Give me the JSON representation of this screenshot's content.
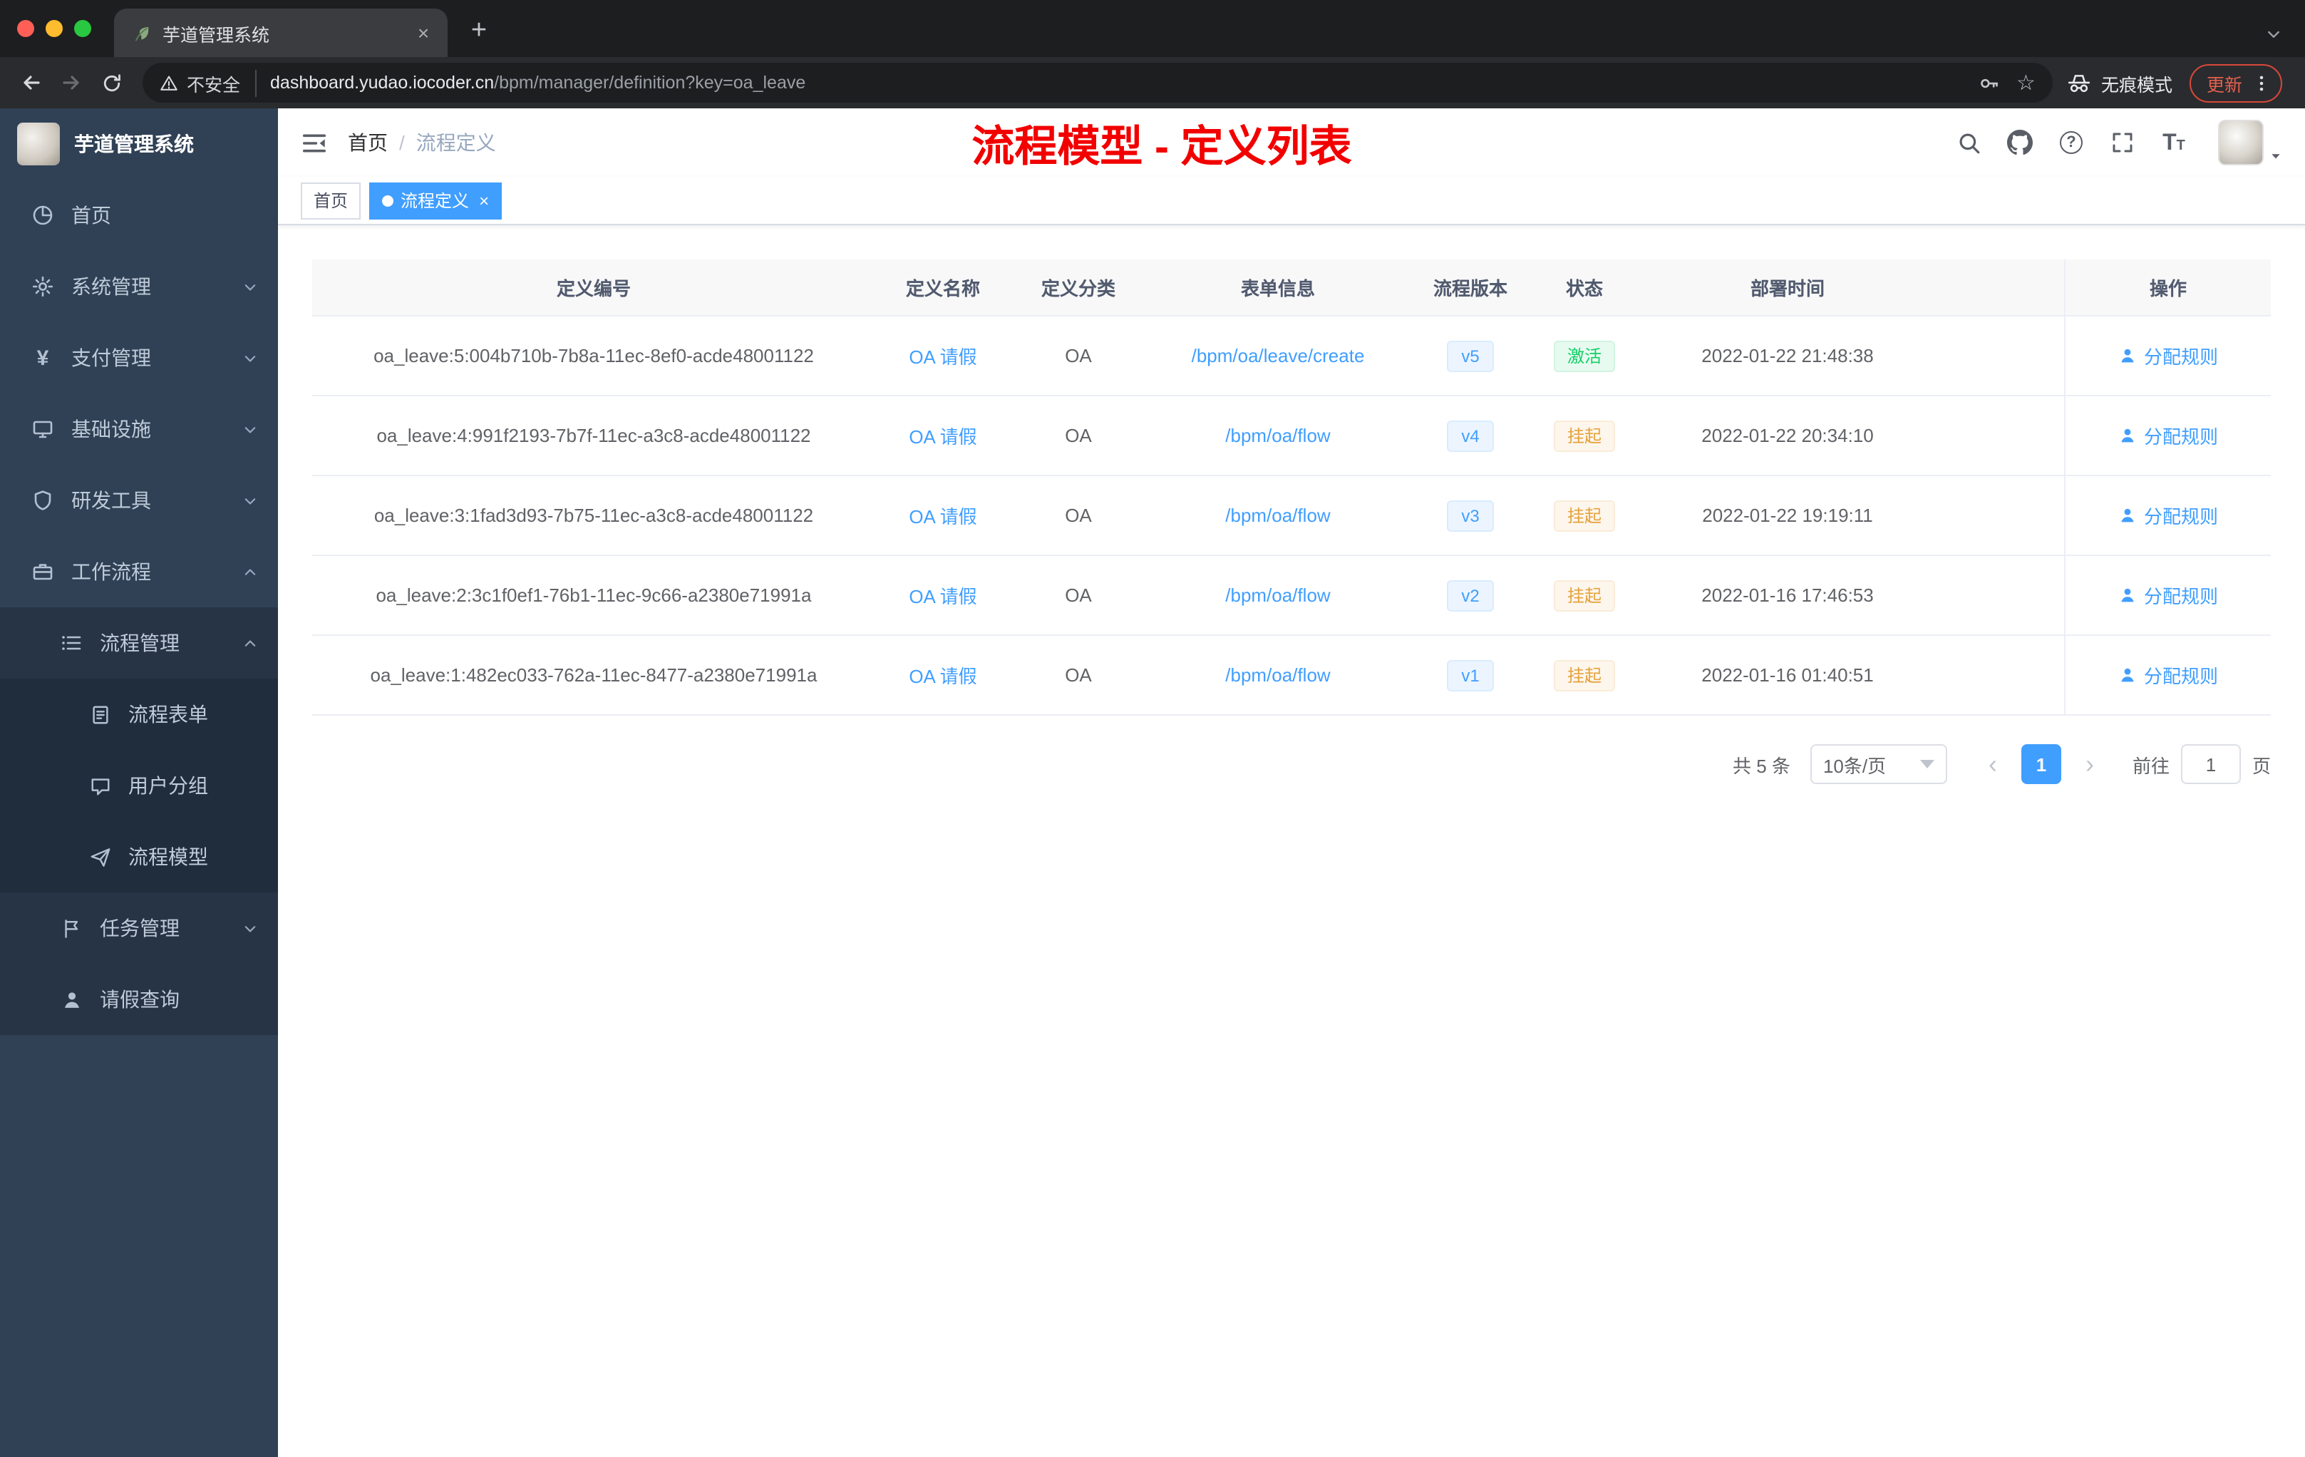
{
  "colors": {
    "accent_blue": "#409eff",
    "annotation_red": "#f20000",
    "status_active_green": "#13ce66",
    "status_suspend_orange": "#e6a23c",
    "sidebar_bg": "#304156",
    "chrome_dark": "#1d1e20"
  },
  "browser": {
    "tab_title": "芋道管理系统",
    "tab_close_glyph": "×",
    "new_tab_glyph": "+",
    "security_label": "不安全",
    "url_host": "dashboard.yudao.iocoder.cn",
    "url_path": "/bpm/manager/definition?key=oa_leave",
    "star_glyph": "☆",
    "incognito_label": "无痕模式",
    "update_label": "更新"
  },
  "sidebar": {
    "logo_title": "芋道管理系统",
    "items": [
      {
        "label": "首页",
        "icon": "dashboard-icon"
      },
      {
        "label": "系统管理",
        "icon": "gear-icon",
        "expand": "down"
      },
      {
        "label": "支付管理",
        "icon": "yen-icon",
        "glyph": "¥",
        "expand": "down"
      },
      {
        "label": "基础设施",
        "icon": "monitor-icon",
        "expand": "down"
      },
      {
        "label": "研发工具",
        "icon": "shield-icon",
        "expand": "down"
      },
      {
        "label": "工作流程",
        "icon": "briefcase-icon",
        "expand": "up"
      },
      {
        "label": "流程管理",
        "icon": "list-icon",
        "expand": "up",
        "level": 1
      },
      {
        "label": "流程表单",
        "icon": "form-icon",
        "level": 2
      },
      {
        "label": "用户分组",
        "icon": "chat-icon",
        "level": 2
      },
      {
        "label": "流程模型",
        "icon": "send-icon",
        "level": 2
      },
      {
        "label": "任务管理",
        "icon": "flag-icon",
        "expand": "down",
        "level": 1
      },
      {
        "label": "请假查询",
        "icon": "person-icon",
        "level": 1
      }
    ]
  },
  "header": {
    "breadcrumb": {
      "home": "首页",
      "separator": "/",
      "current": "流程定义"
    },
    "annotation": "流程模型 - 定义列表",
    "question_glyph": "?",
    "font_large_glyph": "T",
    "font_small_glyph": "T"
  },
  "tags": {
    "items": [
      {
        "label": "首页",
        "active": false
      },
      {
        "label": "流程定义",
        "active": true,
        "close_glyph": "×"
      }
    ]
  },
  "table": {
    "columns": [
      "定义编号",
      "定义名称",
      "定义分类",
      "表单信息",
      "流程版本",
      "状态",
      "部署时间",
      "操作"
    ],
    "rows": [
      {
        "id": "oa_leave:5:004b710b-7b8a-11ec-8ef0-acde48001122",
        "name": "OA 请假",
        "category": "OA",
        "form": "/bpm/oa/leave/create",
        "version": "v5",
        "status": "激活",
        "deploy_time": "2022-01-22 21:48:38",
        "action": "分配规则"
      },
      {
        "id": "oa_leave:4:991f2193-7b7f-11ec-a3c8-acde48001122",
        "name": "OA 请假",
        "category": "OA",
        "form": "/bpm/oa/flow",
        "version": "v4",
        "status": "挂起",
        "deploy_time": "2022-01-22 20:34:10",
        "action": "分配规则"
      },
      {
        "id": "oa_leave:3:1fad3d93-7b75-11ec-a3c8-acde48001122",
        "name": "OA 请假",
        "category": "OA",
        "form": "/bpm/oa/flow",
        "version": "v3",
        "status": "挂起",
        "deploy_time": "2022-01-22 19:19:11",
        "action": "分配规则"
      },
      {
        "id": "oa_leave:2:3c1f0ef1-76b1-11ec-9c66-a2380e71991a",
        "name": "OA 请假",
        "category": "OA",
        "form": "/bpm/oa/flow",
        "version": "v2",
        "status": "挂起",
        "deploy_time": "2022-01-16 17:46:53",
        "action": "分配规则"
      },
      {
        "id": "oa_leave:1:482ec033-762a-11ec-8477-a2380e71991a",
        "name": "OA 请假",
        "category": "OA",
        "form": "/bpm/oa/flow",
        "version": "v1",
        "status": "挂起",
        "deploy_time": "2022-01-16 01:40:51",
        "action": "分配规则"
      }
    ]
  },
  "pagination": {
    "total": "共 5 条",
    "page_size": "10条/页",
    "prev_glyph": "‹",
    "current_page": "1",
    "next_glyph": "›",
    "goto_label": "前往",
    "goto_value": "1",
    "page_unit": "页"
  }
}
